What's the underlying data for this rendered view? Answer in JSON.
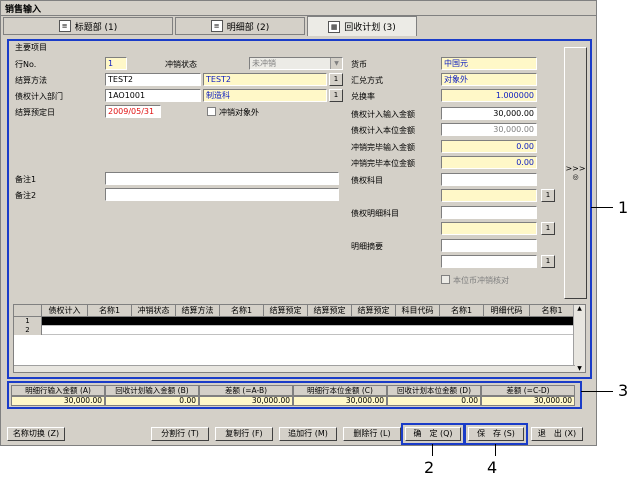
{
  "window": {
    "title": "销售输入"
  },
  "tabs": [
    {
      "label": "标题部 (1)",
      "active": false
    },
    {
      "label": "明细部 (2)",
      "active": false
    },
    {
      "label": "回收计划 (3)",
      "active": true
    }
  ],
  "main_section": {
    "title": "主要项目",
    "row_no_label": "行No.",
    "row_no_value": "1",
    "offset_status_label": "冲销状态",
    "offset_status_value": "未冲销",
    "settlement_method_label": "结算方法",
    "settlement_method_code": "TEST2",
    "settlement_method_name": "TEST2",
    "receivable_dept_label": "债权计入部门",
    "receivable_dept_code": "1AO1001",
    "receivable_dept_name": "制造科",
    "settlement_date_label": "结算预定日",
    "settlement_date_value": "2009/05/31",
    "offset_target_exclude_label": "冲销对象外",
    "currency_label": "货币",
    "currency_value": "中国元",
    "exchange_method_label": "汇兑方式",
    "exchange_method_value": "对象外",
    "exchange_rate_label": "兑换率",
    "exchange_rate_value": "1.000000",
    "receivable_input_amount_label": "债权计入输入金额",
    "receivable_input_amount_value": "30,000.00",
    "receivable_base_amount_label": "债权计入本位金额",
    "receivable_base_amount_value": "30,000.00",
    "offset_done_input_label": "冲销完毕输入金额",
    "offset_done_input_value": "0.00",
    "offset_done_base_label": "冲销完毕本位金额",
    "offset_done_base_value": "0.00",
    "receivable_account_label": "债权科目",
    "receivable_detail_account_label": "债权明细科目",
    "detail_summary_label": "明细摘要",
    "base_offset_check_label": "本位币冲销核对",
    "remark1_label": "备注1",
    "remark2_label": "备注2",
    "lookup_button": "1",
    "side_button": ">>>"
  },
  "grid": {
    "columns": [
      "债权计入",
      "名称1",
      "冲销状态",
      "结算方法",
      "名称1",
      "结算预定",
      "结算预定",
      "结算预定",
      "科目代码",
      "名称1",
      "明细代码",
      "名称1"
    ],
    "rows": [
      "1",
      "2"
    ]
  },
  "summary": {
    "headers": [
      "明细行输入金额 (A)",
      "回收计划输入金额 (B)",
      "差额 (=A-B)",
      "明细行本位金额 (C)",
      "回收计划本位金额 (D)",
      "差额 (=C-D)"
    ],
    "values": [
      "30,000.00",
      "0.00",
      "30,000.00",
      "30,000.00",
      "0.00",
      "30,000.00"
    ]
  },
  "buttons": {
    "name_switch": "名称切换 (Z)",
    "split_row": "分割行 (T)",
    "copy_row": "复制行 (F)",
    "add_row": "追加行 (M)",
    "delete_row": "删除行 (L)",
    "confirm": "确　定 (Q)",
    "save": "保　存 (S)",
    "exit": "退　出 (X)"
  },
  "callouts": [
    "1",
    "2",
    "3",
    "4"
  ]
}
